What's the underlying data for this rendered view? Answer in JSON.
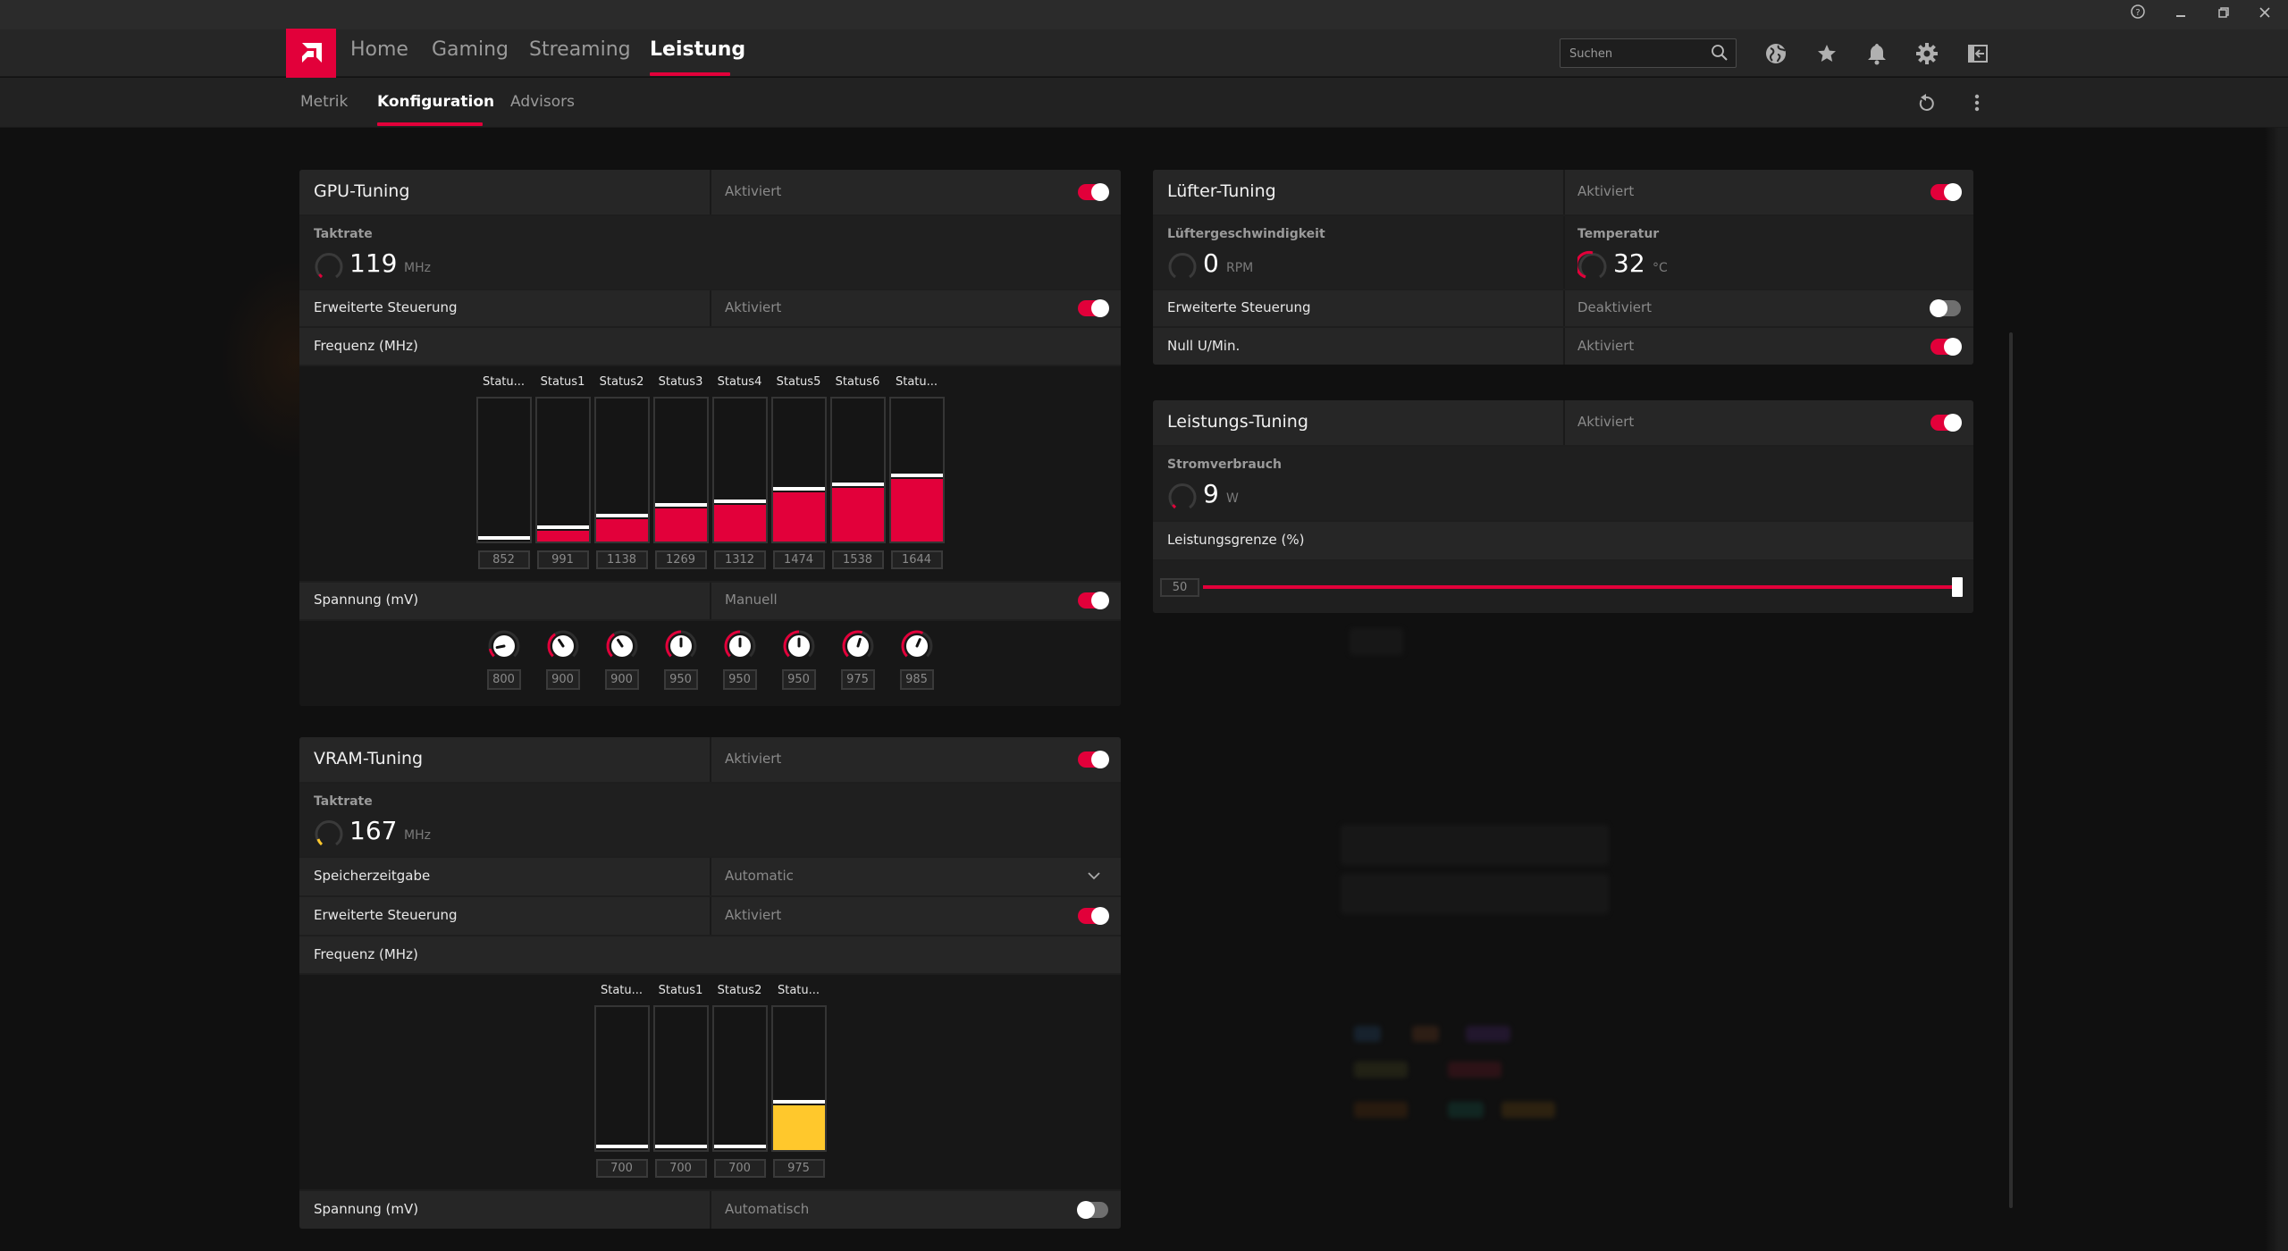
{
  "window": {
    "controls": [
      {
        "name": "help-icon",
        "glyph": "?"
      },
      {
        "name": "minimize-icon",
        "glyph": "–"
      },
      {
        "name": "restore-icon",
        "glyph": "❐"
      },
      {
        "name": "close-icon",
        "glyph": "✕"
      }
    ]
  },
  "colors": {
    "accent": "#e2003a",
    "vram_accent": "#ffc82c",
    "panel_row": "#262626",
    "panel_body": "#1f1f1f"
  },
  "nav": {
    "logo": "amd-logo",
    "items": [
      {
        "label": "Home",
        "active": false
      },
      {
        "label": "Gaming",
        "active": false
      },
      {
        "label": "Streaming",
        "active": false
      },
      {
        "label": "Leistung",
        "active": true
      }
    ],
    "search": {
      "placeholder": "Suchen",
      "value": ""
    },
    "icons": [
      "globe-icon",
      "star-icon",
      "bell-icon",
      "gear-icon",
      "sign-out-icon"
    ]
  },
  "subnav": {
    "items": [
      {
        "label": "Metrik",
        "active": false
      },
      {
        "label": "Konfiguration",
        "active": true
      },
      {
        "label": "Advisors",
        "active": false
      }
    ],
    "actions": [
      "reset-icon",
      "more-options-icon"
    ]
  },
  "gpu_tuning": {
    "title": "GPU-Tuning",
    "status": "Aktiviert",
    "enabled": true,
    "clock": {
      "label": "Taktrate",
      "value": "119",
      "unit": "MHz"
    },
    "advanced": {
      "label": "Erweiterte Steuerung",
      "status": "Aktiviert",
      "enabled": true
    },
    "frequency": {
      "label": "Frequenz (MHz)",
      "states": [
        {
          "label": "Statu...",
          "value": 852
        },
        {
          "label": "Status1",
          "value": 991
        },
        {
          "label": "Status2",
          "value": 1138
        },
        {
          "label": "Status3",
          "value": 1269
        },
        {
          "label": "Status4",
          "value": 1312
        },
        {
          "label": "Status5",
          "value": 1474
        },
        {
          "label": "Status6",
          "value": 1538
        },
        {
          "label": "Statu...",
          "value": 1644
        }
      ],
      "range": [
        852,
        2600
      ]
    },
    "voltage": {
      "label": "Spannung (mV)",
      "status": "Manuell",
      "enabled": true,
      "values": [
        800,
        900,
        900,
        950,
        950,
        950,
        975,
        985
      ],
      "range": [
        750,
        1150
      ]
    }
  },
  "vram_tuning": {
    "title": "VRAM-Tuning",
    "status": "Aktiviert",
    "enabled": true,
    "clock": {
      "label": "Taktrate",
      "value": "167",
      "unit": "MHz"
    },
    "timing": {
      "label": "Speicherzeitgabe",
      "value": "Automatic"
    },
    "advanced": {
      "label": "Erweiterte Steuerung",
      "status": "Aktiviert",
      "enabled": true
    },
    "frequency": {
      "label": "Frequenz (MHz)",
      "states": [
        {
          "label": "Statu...",
          "value": 700
        },
        {
          "label": "Status1",
          "value": 700
        },
        {
          "label": "Status2",
          "value": 700
        },
        {
          "label": "Statu...",
          "value": 975
        }
      ],
      "range": [
        700,
        1550
      ]
    },
    "voltage": {
      "label": "Spannung (mV)",
      "status": "Automatisch",
      "enabled": false
    }
  },
  "fan_tuning": {
    "title": "Lüfter-Tuning",
    "status": "Aktiviert",
    "enabled": true,
    "speed": {
      "label": "Lüftergeschwindigkeit",
      "value": "0",
      "unit": "RPM"
    },
    "temperature": {
      "label": "Temperatur",
      "value": "32",
      "unit": "°C"
    },
    "advanced": {
      "label": "Erweiterte Steuerung",
      "status": "Deaktiviert",
      "enabled": false
    },
    "zero_rpm": {
      "label": "Null U/Min.",
      "status": "Aktiviert",
      "enabled": true
    }
  },
  "power_tuning": {
    "title": "Leistungs-Tuning",
    "status": "Aktiviert",
    "enabled": true,
    "consumption": {
      "label": "Stromverbrauch",
      "value": "9",
      "unit": "W"
    },
    "limit": {
      "label": "Leistungsgrenze (%)",
      "value": "50",
      "fraction": 1.0
    }
  }
}
